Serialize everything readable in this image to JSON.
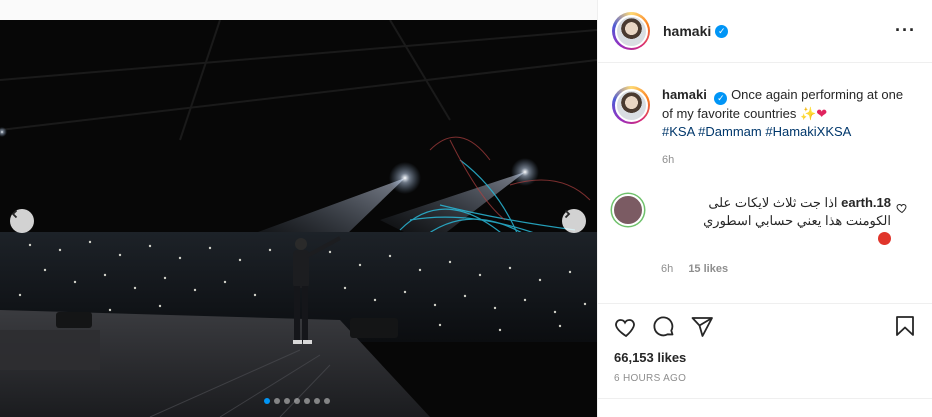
{
  "post": {
    "username": "hamaki",
    "more_icon": "more-horizontal-icon"
  },
  "caption": {
    "username": "hamaki",
    "text": "Once again performing at one of my favorite countries",
    "emoji_1": "✨",
    "emoji_2": "❤",
    "hashtags": [
      "#KSA",
      "#Dammam",
      "#HamakiXKSA"
    ],
    "time": "6h"
  },
  "comment": {
    "username": "earth.18",
    "text": "اذا جت ثلاث لايكات على الكومنت هذا يعني حسابي اسطوري",
    "time": "6h",
    "likes": "15 likes"
  },
  "actions": {
    "like_icon": "heart-icon",
    "comment_icon": "comment-icon",
    "share_icon": "paper-plane-icon",
    "save_icon": "bookmark-icon",
    "likes_count": "66,153 likes",
    "timestamp": "6 HOURS AGO"
  },
  "carousel": {
    "slide_count": 7,
    "active_index": 0
  },
  "colors": {
    "accent": "#0095f6",
    "hashtag": "#00376b",
    "muted": "#8e8e8e"
  }
}
